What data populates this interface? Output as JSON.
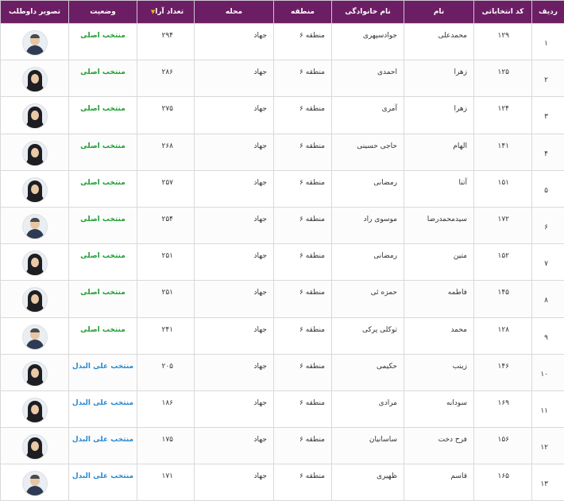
{
  "headers": {
    "row": "ردیف",
    "code": "کد انتخاباتی",
    "first_name": "نام",
    "last_name": "نام خانوادگی",
    "region": "منطقه",
    "neighborhood": "محله",
    "votes": "تعداد آرا",
    "status": "وضعیت",
    "photo": "تصویر داوطلب"
  },
  "sort_icon": "sort-down-icon",
  "colors": {
    "header_bg": "#6b1e63",
    "status_main": "#1f9e33",
    "status_alt": "#2a8ad1",
    "sort": "#f2b21a"
  },
  "rows": [
    {
      "row": "۱",
      "code": "۱۲۹",
      "first_name": "محمدعلی",
      "last_name": "جوادسپهری",
      "region": "منطقه ۶",
      "neighborhood": "جهاد",
      "votes": "۲۹۴",
      "status": "منتخب اصلی",
      "status_type": "main",
      "photo": "male"
    },
    {
      "row": "۲",
      "code": "۱۲۵",
      "first_name": "زهرا",
      "last_name": "احمدی",
      "region": "منطقه ۶",
      "neighborhood": "جهاد",
      "votes": "۲۸۶",
      "status": "منتخب اصلی",
      "status_type": "main",
      "photo": "female"
    },
    {
      "row": "۳",
      "code": "۱۲۴",
      "first_name": "زهرا",
      "last_name": "آمری",
      "region": "منطقه ۶",
      "neighborhood": "جهاد",
      "votes": "۲۷۵",
      "status": "منتخب اصلی",
      "status_type": "main",
      "photo": "female"
    },
    {
      "row": "۴",
      "code": "۱۴۱",
      "first_name": "الهام",
      "last_name": "حاجی حسینی",
      "region": "منطقه ۶",
      "neighborhood": "جهاد",
      "votes": "۲۶۸",
      "status": "منتخب اصلی",
      "status_type": "main",
      "photo": "female"
    },
    {
      "row": "۵",
      "code": "۱۵۱",
      "first_name": "آتنا",
      "last_name": "رمضانی",
      "region": "منطقه ۶",
      "neighborhood": "جهاد",
      "votes": "۲۵۷",
      "status": "منتخب اصلی",
      "status_type": "main",
      "photo": "female"
    },
    {
      "row": "۶",
      "code": "۱۷۲",
      "first_name": "سیدمحمدرضا",
      "last_name": "موسوی راد",
      "region": "منطقه ۶",
      "neighborhood": "جهاد",
      "votes": "۲۵۴",
      "status": "منتخب اصلی",
      "status_type": "main",
      "photo": "male"
    },
    {
      "row": "۷",
      "code": "۱۵۲",
      "first_name": "متین",
      "last_name": "رمضانی",
      "region": "منطقه ۶",
      "neighborhood": "جهاد",
      "votes": "۲۵۱",
      "status": "منتخب اصلی",
      "status_type": "main",
      "photo": "female"
    },
    {
      "row": "۸",
      "code": "۱۴۵",
      "first_name": "فاطمه",
      "last_name": "حمزه ئی",
      "region": "منطقه ۶",
      "neighborhood": "جهاد",
      "votes": "۲۵۱",
      "status": "منتخب اصلی",
      "status_type": "main",
      "photo": "female"
    },
    {
      "row": "۹",
      "code": "۱۲۸",
      "first_name": "محمد",
      "last_name": "توکلی پرکی",
      "region": "منطقه ۶",
      "neighborhood": "جهاد",
      "votes": "۲۴۱",
      "status": "منتخب اصلی",
      "status_type": "main",
      "photo": "male"
    },
    {
      "row": "۱۰",
      "code": "۱۴۶",
      "first_name": "زینب",
      "last_name": "حکیمی",
      "region": "منطقه ۶",
      "neighborhood": "جهاد",
      "votes": "۲۰۵",
      "status": "منتخب علی البدل",
      "status_type": "alt",
      "photo": "female"
    },
    {
      "row": "۱۱",
      "code": "۱۶۹",
      "first_name": "سودابه",
      "last_name": "مرادی",
      "region": "منطقه ۶",
      "neighborhood": "جهاد",
      "votes": "۱۸۶",
      "status": "منتخب علی البدل",
      "status_type": "alt",
      "photo": "female"
    },
    {
      "row": "۱۲",
      "code": "۱۵۶",
      "first_name": "فرح دخت",
      "last_name": "ساسانیان",
      "region": "منطقه ۶",
      "neighborhood": "جهاد",
      "votes": "۱۷۵",
      "status": "منتخب علی البدل",
      "status_type": "alt",
      "photo": "female"
    },
    {
      "row": "۱۳",
      "code": "۱۶۵",
      "first_name": "قاسم",
      "last_name": "ظهیری",
      "region": "منطقه ۶",
      "neighborhood": "جهاد",
      "votes": "۱۷۱",
      "status": "منتخب علی البدل",
      "status_type": "alt",
      "photo": "male"
    }
  ]
}
